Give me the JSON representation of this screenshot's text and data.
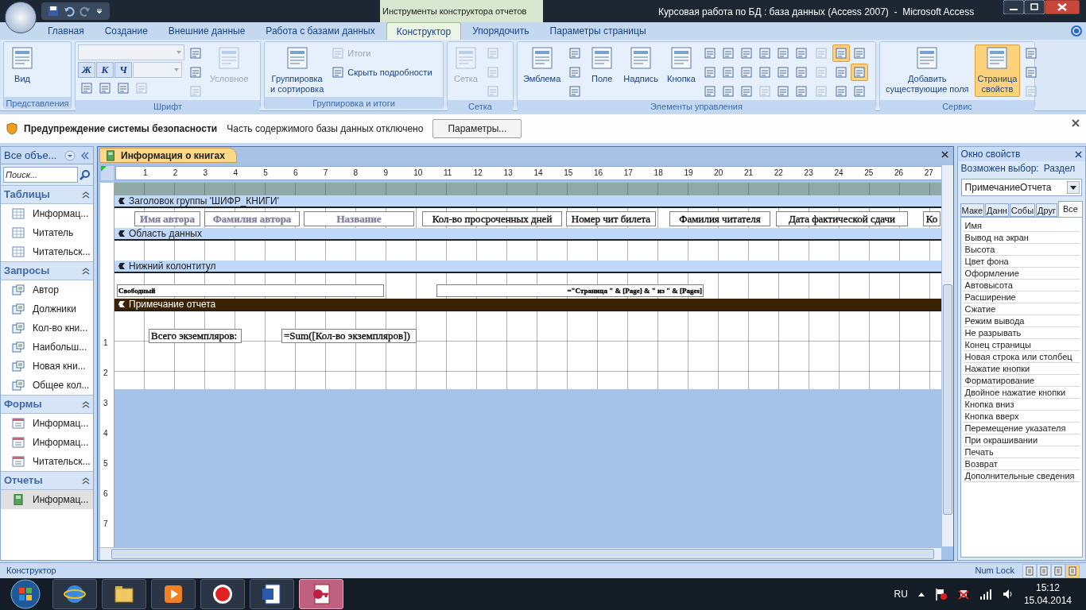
{
  "window": {
    "context_title": "Инструменты конструктора отчетов",
    "title": "Курсовая работа по БД : база данных (Access 2007)  -  Microsoft Access"
  },
  "ribbon_tabs": [
    {
      "label": "Главная",
      "selected": false
    },
    {
      "label": "Создание",
      "selected": false
    },
    {
      "label": "Внешние данные",
      "selected": false
    },
    {
      "label": "Работа с базами данных",
      "selected": false
    },
    {
      "label": "Конструктор",
      "selected": true
    },
    {
      "label": "Упорядочить",
      "selected": false
    },
    {
      "label": "Параметры страницы",
      "selected": false
    }
  ],
  "ribbon_groups": [
    {
      "label": "Представления",
      "columns": [
        [
          [
            {
              "kind": "large",
              "label": "Вид",
              "disabled": false,
              "pressed": false
            }
          ]
        ]
      ]
    },
    {
      "label": "Шрифт",
      "columns": [
        [
          [
            {
              "kind": "combo",
              "disabled": true,
              "pressed": false
            }
          ],
          [
            {
              "kind": "char",
              "label": "Ж",
              "disabled": false,
              "pressed": false
            },
            {
              "kind": "char",
              "label": "К",
              "disabled": false,
              "pressed": false
            },
            {
              "kind": "char",
              "label": "Ч",
              "disabled": false,
              "pressed": false
            },
            {
              "kind": "combo",
              "disabled": true,
              "pressed": false
            }
          ],
          [
            {
              "kind": "icon",
              "disabled": false,
              "pressed": false
            },
            {
              "kind": "icon",
              "disabled": false,
              "pressed": false
            },
            {
              "kind": "icon",
              "disabled": false,
              "pressed": false
            },
            {
              "kind": "icon",
              "disabled": true,
              "pressed": false
            }
          ]
        ],
        [
          [
            {
              "kind": "icon",
              "disabled": false,
              "pressed": false
            }
          ],
          [
            {
              "kind": "icon",
              "disabled": false,
              "pressed": false
            }
          ],
          [
            {
              "kind": "icon",
              "disabled": true,
              "pressed": false
            }
          ]
        ],
        [
          [
            {
              "kind": "large",
              "label": "Условное",
              "disabled": true,
              "pressed": false
            }
          ]
        ]
      ]
    },
    {
      "label": "Группировка и итоги",
      "columns": [
        [
          [
            {
              "kind": "large",
              "label": "Группировка\nи сортировка",
              "disabled": false,
              "pressed": false
            }
          ]
        ],
        [
          [
            {
              "kind": "small",
              "label": "Итоги",
              "disabled": true,
              "pressed": false
            }
          ],
          [
            {
              "kind": "small",
              "label": "Скрыть подробности",
              "disabled": false,
              "pressed": false
            }
          ]
        ]
      ]
    },
    {
      "label": "Сетка",
      "columns": [
        [
          [
            {
              "kind": "large",
              "label": "Сетка",
              "disabled": true,
              "pressed": false
            }
          ]
        ],
        [
          [
            {
              "kind": "icon",
              "disabled": true,
              "pressed": false
            }
          ],
          [
            {
              "kind": "icon",
              "disabled": true,
              "pressed": false
            }
          ],
          [
            {
              "kind": "icon",
              "disabled": true,
              "pressed": false
            }
          ]
        ]
      ]
    },
    {
      "label": "Элементы управления",
      "columns": [
        [
          [
            {
              "kind": "large",
              "label": "Эмблема",
              "disabled": false,
              "pressed": false
            }
          ]
        ],
        [
          [
            {
              "kind": "icon",
              "disabled": false,
              "pressed": false
            }
          ],
          [
            {
              "kind": "icon",
              "disabled": false,
              "pressed": false
            }
          ],
          [
            {
              "kind": "icon",
              "disabled": false,
              "pressed": false
            }
          ]
        ],
        [
          [
            {
              "kind": "large",
              "label": "Поле",
              "disabled": false,
              "pressed": false
            }
          ]
        ],
        [
          [
            {
              "kind": "large",
              "label": "Надпись",
              "disabled": false,
              "pressed": false
            }
          ]
        ],
        [
          [
            {
              "kind": "large",
              "label": "Кнопка",
              "disabled": false,
              "pressed": false
            }
          ]
        ],
        [
          [
            {
              "kind": "icon",
              "disabled": false,
              "pressed": false
            },
            {
              "kind": "icon",
              "disabled": false,
              "pressed": false
            },
            {
              "kind": "icon",
              "disabled": false,
              "pressed": false
            },
            {
              "kind": "icon",
              "disabled": false,
              "pressed": false
            },
            {
              "kind": "icon",
              "disabled": false,
              "pressed": false
            },
            {
              "kind": "icon",
              "disabled": false,
              "pressed": false
            }
          ],
          [
            {
              "kind": "icon",
              "disabled": false,
              "pressed": false
            },
            {
              "kind": "icon",
              "disabled": false,
              "pressed": false
            },
            {
              "kind": "icon",
              "disabled": false,
              "pressed": false
            },
            {
              "kind": "icon",
              "disabled": false,
              "pressed": false
            },
            {
              "kind": "icon",
              "disabled": false,
              "pressed": false
            },
            {
              "kind": "icon",
              "disabled": false,
              "pressed": false
            }
          ],
          [
            {
              "kind": "icon",
              "disabled": false,
              "pressed": false
            },
            {
              "kind": "icon",
              "disabled": false,
              "pressed": false
            },
            {
              "kind": "icon",
              "disabled": false,
              "pressed": false
            },
            {
              "kind": "icon",
              "disabled": true,
              "pressed": false
            },
            {
              "kind": "icon",
              "disabled": false,
              "pressed": false
            },
            {
              "kind": "icon",
              "disabled": false,
              "pressed": false
            }
          ]
        ],
        [
          [
            {
              "kind": "icon",
              "disabled": true,
              "pressed": false
            }
          ],
          [
            {
              "kind": "icon",
              "disabled": true,
              "pressed": false
            }
          ],
          [
            {
              "kind": "icon",
              "disabled": true,
              "pressed": false
            }
          ]
        ],
        [
          [
            {
              "kind": "icon",
              "disabled": false,
              "pressed": true
            },
            {
              "kind": "icon",
              "disabled": false,
              "pressed": false
            }
          ],
          [
            {
              "kind": "icon",
              "disabled": false,
              "pressed": false
            },
            {
              "kind": "icon",
              "disabled": false,
              "pressed": true
            }
          ],
          [
            {
              "kind": "icon",
              "disabled": false,
              "pressed": false
            },
            {
              "kind": "icon",
              "disabled": false,
              "pressed": false
            }
          ]
        ]
      ]
    },
    {
      "label": "Сервис",
      "columns": [
        [
          [
            {
              "kind": "large",
              "label": "Добавить\nсуществующие поля",
              "disabled": false,
              "pressed": false
            }
          ]
        ],
        [
          [
            {
              "kind": "large",
              "label": "Страница\nсвойств",
              "disabled": false,
              "pressed": true
            }
          ]
        ],
        [
          [
            {
              "kind": "icon",
              "disabled": false,
              "pressed": false
            }
          ],
          [
            {
              "kind": "icon",
              "disabled": false,
              "pressed": false
            }
          ],
          [
            {
              "kind": "icon",
              "disabled": true,
              "pressed": false
            }
          ]
        ]
      ]
    }
  ],
  "security_bar": {
    "title": "Предупреждение системы безопасности",
    "message": "Часть содержимого базы данных отключено",
    "button": "Параметры..."
  },
  "navigation": {
    "header": "Все объе...",
    "search_placeholder": "Поиск...",
    "groups": [
      {
        "label": "Таблицы",
        "kind": "table",
        "expanded": true,
        "items": [
          {
            "label": "Информац...",
            "selected": false
          },
          {
            "label": "Читатель",
            "selected": false
          },
          {
            "label": "Читательск...",
            "selected": false
          }
        ]
      },
      {
        "label": "Запросы",
        "kind": "query",
        "expanded": true,
        "items": [
          {
            "label": "Автор",
            "selected": false
          },
          {
            "label": "Должники",
            "selected": false
          },
          {
            "label": "Кол-во кни...",
            "selected": false
          },
          {
            "label": "Наибольш...",
            "selected": false
          },
          {
            "label": "Новая кни...",
            "selected": false
          },
          {
            "label": "Общее кол...",
            "selected": false
          }
        ]
      },
      {
        "label": "Формы",
        "kind": "form",
        "expanded": true,
        "items": [
          {
            "label": "Информац...",
            "selected": false
          },
          {
            "label": "Информац...",
            "selected": false
          },
          {
            "label": "Читательск...",
            "selected": false
          }
        ]
      },
      {
        "label": "Отчеты",
        "kind": "report",
        "expanded": true,
        "items": [
          {
            "label": "Информац...",
            "selected": true
          }
        ]
      }
    ]
  },
  "document": {
    "tab": "Информация о книгах",
    "ruler": [
      "1",
      "2",
      "3",
      "4",
      "5",
      "6",
      "7",
      "8",
      "9",
      "10",
      "11",
      "12",
      "13",
      "14",
      "15",
      "16",
      "17",
      "18",
      "19",
      "20",
      "21",
      "22",
      "23",
      "24",
      "25",
      "26",
      "27"
    ],
    "vertical_ruler": [
      "1",
      "2",
      "3",
      "4",
      "5",
      "6",
      "7"
    ],
    "sections": [
      {
        "label": "Заголовок группы 'ШИФР_КНИГИ'",
        "selected": false,
        "controls": [
          {
            "text": "Имя автора",
            "color": "#7f7f99"
          },
          {
            "text": "Фамилия автора",
            "color": "#7f7f99"
          },
          {
            "text": "Название",
            "color": "#7f7f99"
          },
          {
            "text": "Кол-во просроченных дней",
            "color": "#000000"
          },
          {
            "text": "Номер чит билета",
            "color": "#000000"
          },
          {
            "text": "Фамилия читателя",
            "color": "#000000"
          },
          {
            "text": "Дата фактической сдачи",
            "color": "#000000"
          },
          {
            "text": "Ко",
            "color": "#000000"
          }
        ]
      },
      {
        "label": "Область данных",
        "selected": false
      },
      {
        "label": "Нижний колонтитул",
        "selected": false,
        "controls": [
          {
            "text": "Свободный",
            "color": "#000000"
          },
          {
            "text": "=\"Страница \" & [Page] & \" из \" & [Pages]",
            "color": "#000000"
          }
        ]
      },
      {
        "label": "Примечание отчета",
        "selected": true,
        "controls": [
          {
            "text": "Всего экземпляров:",
            "color": "#000000"
          },
          {
            "text": "=Sum([Кол-во экземпляров])",
            "color": "#000000"
          }
        ]
      }
    ]
  },
  "property_sheet": {
    "title": "Окно свойств",
    "selection_label": "Возможен выбор:",
    "selection_value": "Раздел",
    "object": "ПримечаниеОтчета",
    "tabs": [
      {
        "label": "Маке",
        "selected": false
      },
      {
        "label": "Данн",
        "selected": false
      },
      {
        "label": "Собы",
        "selected": false
      },
      {
        "label": "Друг",
        "selected": false
      },
      {
        "label": "Все",
        "selected": true
      }
    ],
    "properties": [
      "Имя",
      "Вывод на экран",
      "Высота",
      "Цвет фона",
      "Оформление",
      "Автовысота",
      "Расширение",
      "Сжатие",
      "Режим вывода",
      "Не разрывать",
      "Конец страницы",
      "Новая строка или столбец",
      "Нажатие кнопки",
      "Форматирование",
      "Двойное нажатие кнопки",
      "Кнопка вниз",
      "Кнопка вверх",
      "Перемещение указателя",
      "При окрашивании",
      "Печать",
      "Возврат",
      "Дополнительные сведения"
    ]
  },
  "status_bar": {
    "text": "Конструктор",
    "num_lock": "Num Lock",
    "view_buttons": [
      {
        "selected": false
      },
      {
        "selected": false
      },
      {
        "selected": false
      },
      {
        "selected": true
      }
    ]
  },
  "taskbar": {
    "apps": [
      {
        "selected": false
      },
      {
        "selected": false
      },
      {
        "selected": false
      },
      {
        "selected": false
      },
      {
        "selected": false
      },
      {
        "selected": true
      }
    ],
    "language": "RU",
    "time": "15:12",
    "date": "15.04.2014"
  }
}
